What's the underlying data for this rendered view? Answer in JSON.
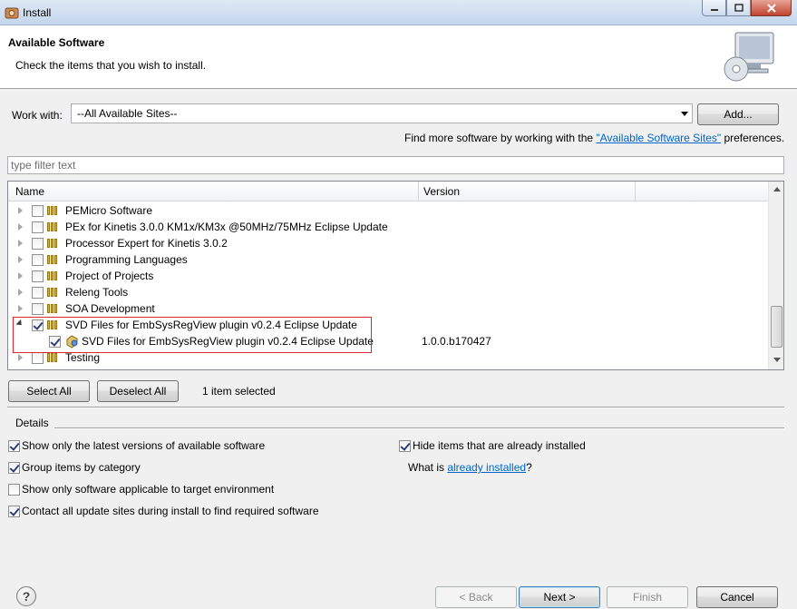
{
  "window": {
    "title": "Install"
  },
  "header": {
    "title": "Available Software",
    "subtitle": "Check the items that you wish to install."
  },
  "work_with": {
    "label": "Work with:",
    "value": "--All Available Sites--",
    "add_label": "Add...",
    "more_prefix": "Find more software by working with the ",
    "more_link": "\"Available Software Sites\"",
    "more_suffix": " preferences."
  },
  "filter": {
    "placeholder": "type filter text"
  },
  "tree": {
    "columns": [
      "Name",
      "Version"
    ],
    "rows": [
      {
        "label": "PEMicro Software",
        "checked": false,
        "expanded": false,
        "version": ""
      },
      {
        "label": "PEx for Kinetis 3.0.0 KM1x/KM3x @50MHz/75MHz Eclipse Update",
        "checked": false,
        "expanded": false,
        "version": ""
      },
      {
        "label": "Processor Expert for Kinetis 3.0.2",
        "checked": false,
        "expanded": false,
        "version": ""
      },
      {
        "label": "Programming Languages",
        "checked": false,
        "expanded": false,
        "version": ""
      },
      {
        "label": "Project of Projects",
        "checked": false,
        "expanded": false,
        "version": ""
      },
      {
        "label": "Releng Tools",
        "checked": false,
        "expanded": false,
        "version": ""
      },
      {
        "label": "SOA Development",
        "checked": false,
        "expanded": false,
        "version": ""
      },
      {
        "label": "SVD Files for EmbSysRegView plugin v0.2.4 Eclipse Update",
        "checked": true,
        "expanded": true,
        "version": ""
      },
      {
        "label": "SVD Files for EmbSysRegView plugin v0.2.4 Eclipse Update",
        "checked": true,
        "child": true,
        "version": "1.0.0.b170427"
      },
      {
        "label": "Testing",
        "checked": false,
        "expanded": false,
        "version": ""
      }
    ]
  },
  "selection": {
    "select_all": "Select All",
    "deselect_all": "Deselect All",
    "status": "1 item selected"
  },
  "details": {
    "label": "Details"
  },
  "options": {
    "latest_versions": {
      "label": "Show only the latest versions of available software",
      "checked": true
    },
    "group_by_category": {
      "label": "Group items by category",
      "checked": true
    },
    "target_env": {
      "label": "Show only software applicable to target environment",
      "checked": false
    },
    "contact_sites": {
      "label": "Contact all update sites during install to find required software",
      "checked": true
    },
    "hide_installed": {
      "label": "Hide items that are already installed",
      "checked": true
    },
    "what_is_prefix": "What is ",
    "what_is_link": "already installed",
    "what_is_suffix": "?"
  },
  "footer": {
    "help": "?",
    "back": "< Back",
    "next": "Next >",
    "finish": "Finish",
    "cancel": "Cancel"
  }
}
